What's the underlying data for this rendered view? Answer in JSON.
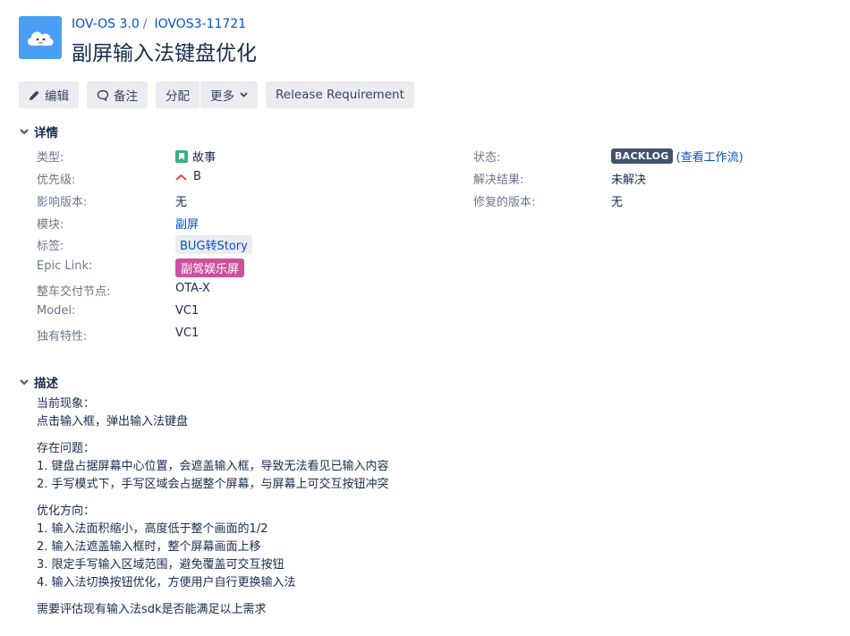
{
  "project": {
    "name": "IOV-OS 3.0",
    "issue_key": "IOVOS3-11721"
  },
  "issue": {
    "title": "副屏输入法键盘优化"
  },
  "toolbar": {
    "edit": "编辑",
    "comment": "备注",
    "assign": "分配",
    "more": "更多",
    "release_requirement": "Release Requirement"
  },
  "details": {
    "heading": "详情",
    "left": [
      {
        "label": "类型:",
        "value": "故事"
      },
      {
        "label": "优先级:",
        "value": "B"
      },
      {
        "label": "影响版本:",
        "value": "无"
      },
      {
        "label": "模块:",
        "value": "副屏"
      },
      {
        "label": "标签:",
        "value": "BUG转Story"
      },
      {
        "label": "Epic Link:",
        "value": "副驾娱乐屏"
      },
      {
        "label": "整车交付节点:",
        "value": "OTA-X"
      },
      {
        "label": "Model:",
        "value": "VC1"
      },
      {
        "label": "独有特性:",
        "value": "VC1"
      }
    ],
    "right": [
      {
        "label": "状态:",
        "value": "BACKLOG",
        "link": "(查看工作流)"
      },
      {
        "label": "解决结果:",
        "value": "未解决"
      },
      {
        "label": "修复的版本:",
        "value": "无"
      }
    ]
  },
  "description": {
    "heading": "描述",
    "blocks": [
      [
        "当前现象：",
        "点击输入框，弹出输入法键盘"
      ],
      [
        "存在问题：",
        "1. 键盘占据屏幕中心位置，会遮盖输入框，导致无法看见已输入内容",
        "2. 手写模式下，手写区域会占据整个屏幕，与屏幕上可交互按钮冲突"
      ],
      [
        "优化方向：",
        "1. 输入法面积缩小，高度低于整个画面的1/2",
        "2. 输入法遮盖输入框时，整个屏幕画面上移",
        "3. 限定手写输入区域范围，避免覆盖可交互按钮",
        "4. 输入法切换按钮优化，方便用户自行更换输入法"
      ],
      [
        "需要评估现有输入法sdk是否能满足以上需求"
      ]
    ]
  },
  "colors": {
    "link": "#0052cc",
    "story": "#36b37e",
    "epic": "#cd519d",
    "status": "#42526e",
    "priority": "#e5493a",
    "avatar": "#4a9ff5"
  }
}
